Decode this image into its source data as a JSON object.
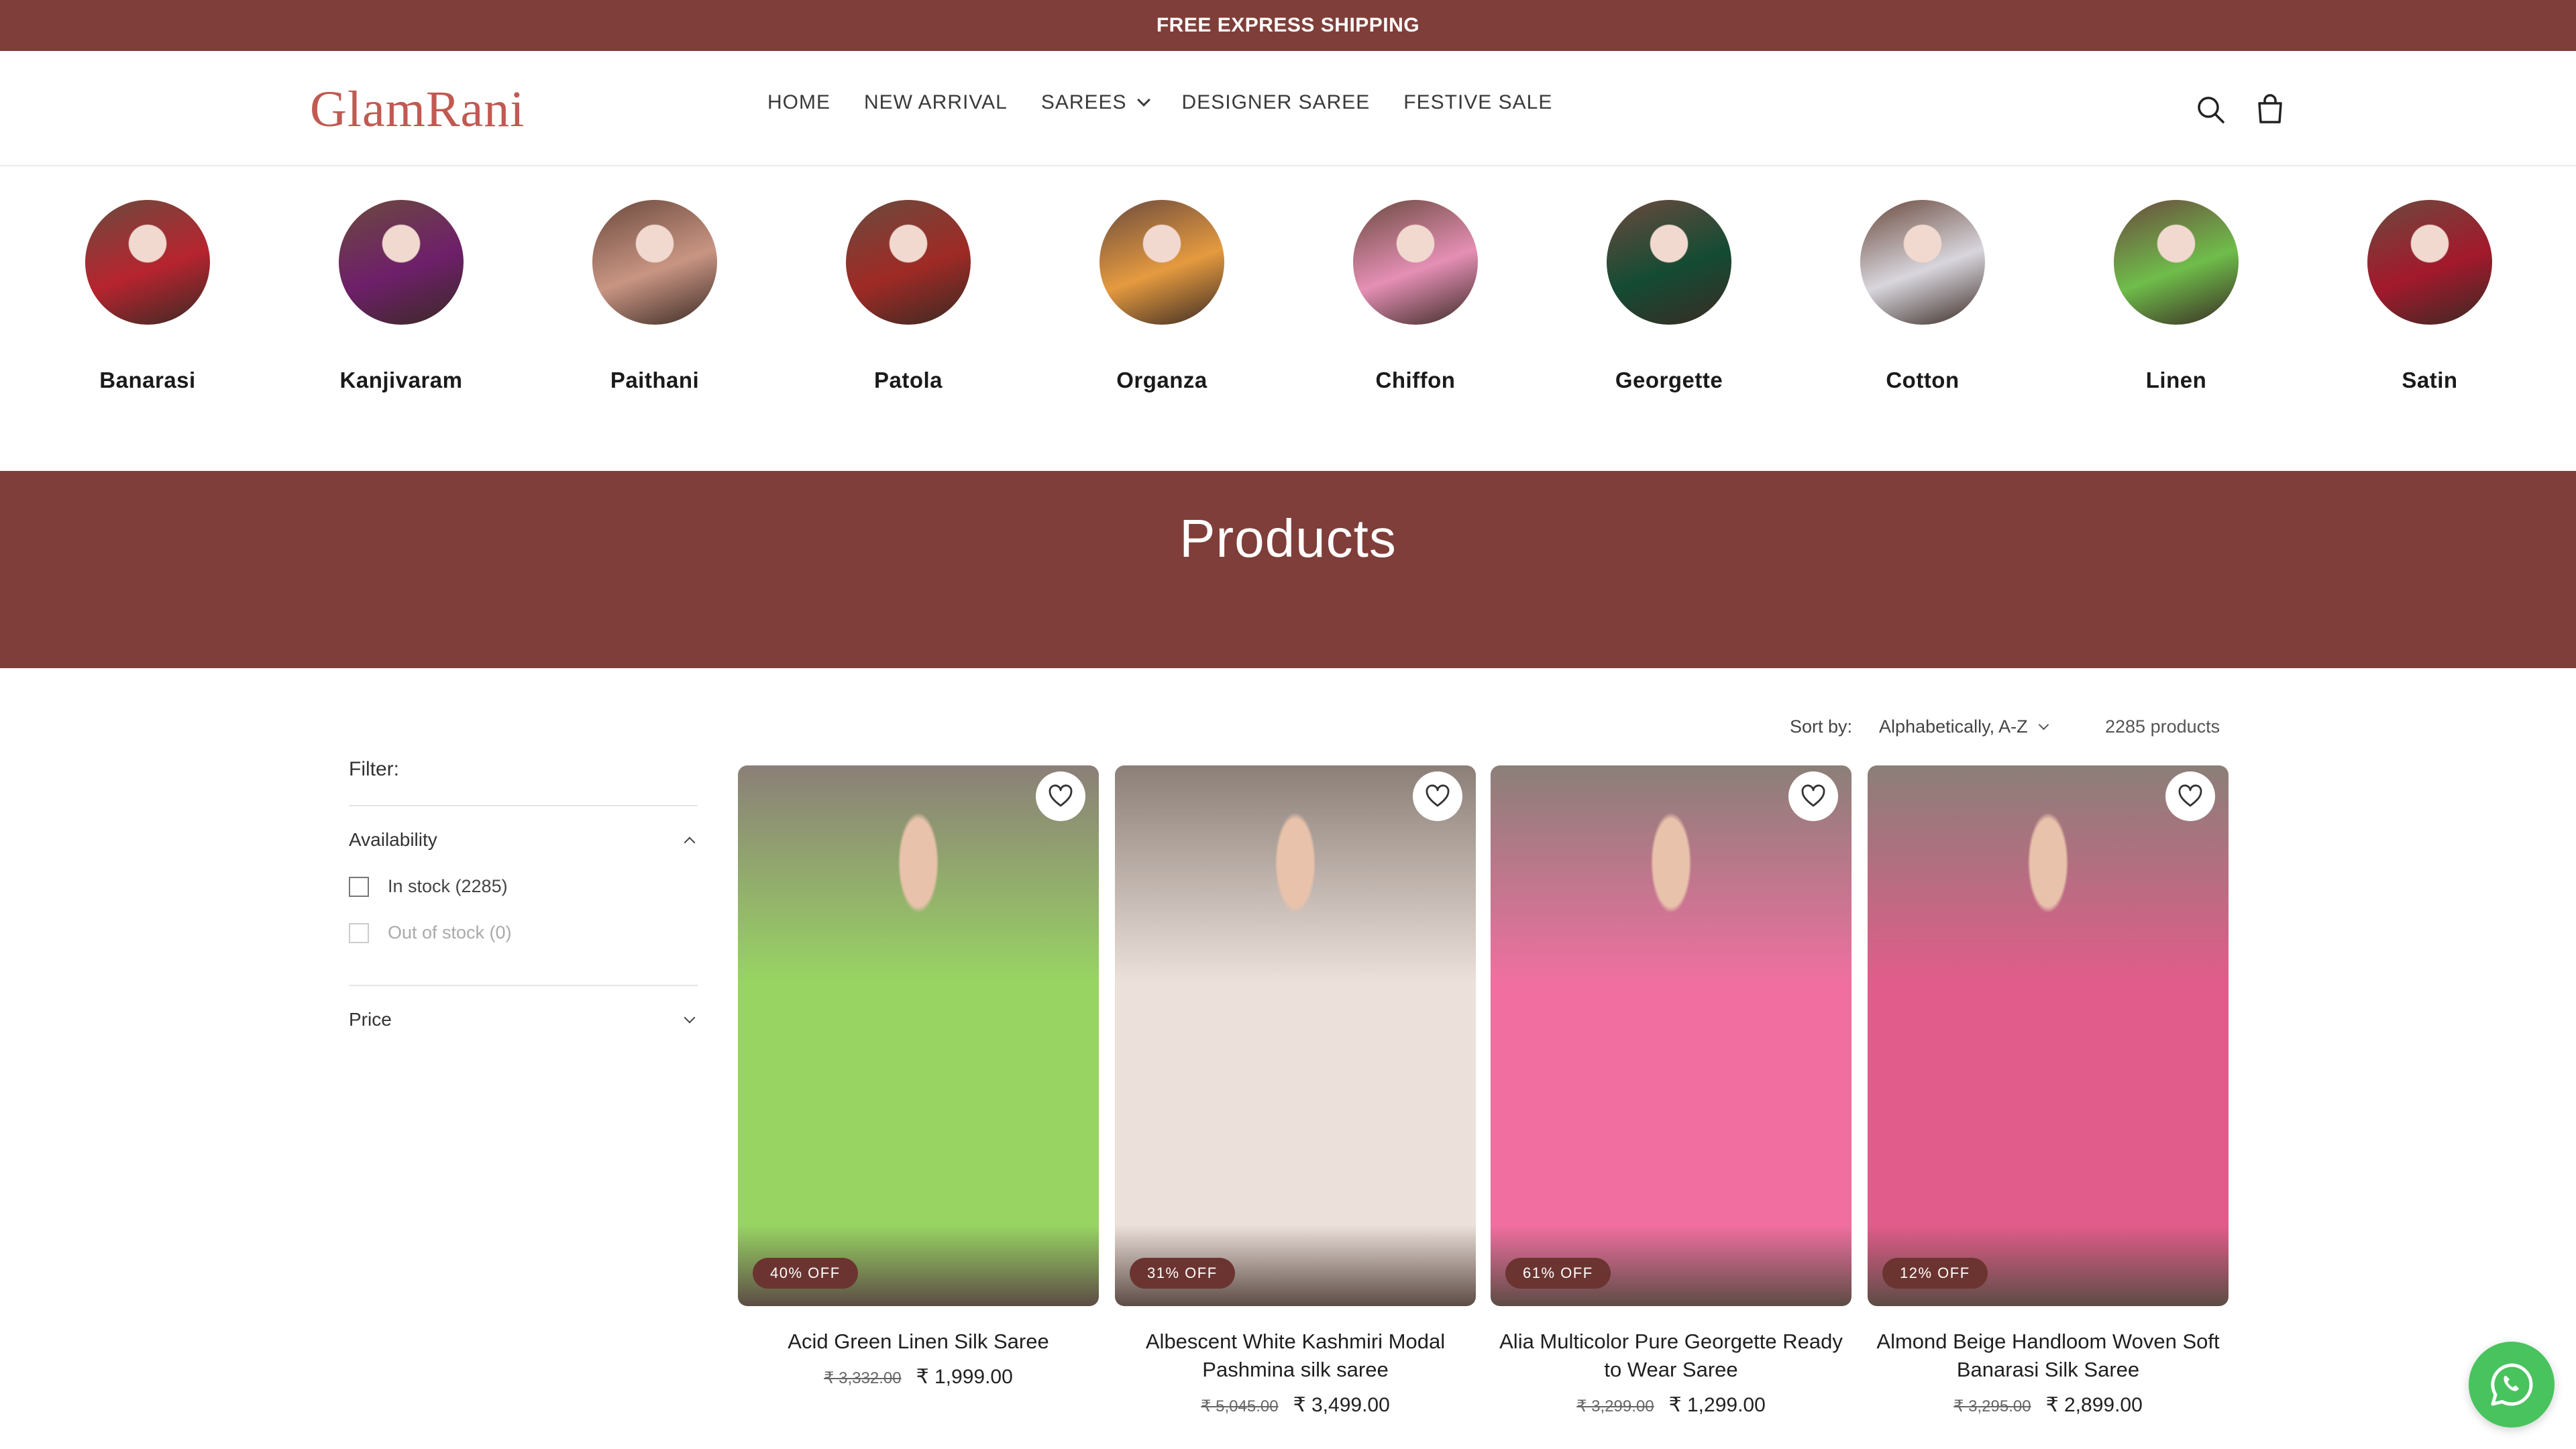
{
  "announcement": {
    "text": "FREE EXPRESS SHIPPING"
  },
  "header": {
    "logo_text": "GlamRani",
    "nav": [
      {
        "label": "HOME"
      },
      {
        "label": "NEW ARRIVAL"
      },
      {
        "label": "SAREES",
        "has_dropdown": true
      },
      {
        "label": "DESIGNER SAREE"
      },
      {
        "label": "FESTIVE SALE"
      }
    ],
    "icons": [
      "search-icon",
      "cart-icon"
    ]
  },
  "categories": [
    {
      "label": "Banarasi",
      "color": "#b7242f"
    },
    {
      "label": "Kanjivaram",
      "color": "#6e1f6a"
    },
    {
      "label": "Paithani",
      "color": "#c99583"
    },
    {
      "label": "Patola",
      "color": "#9f2a25"
    },
    {
      "label": "Organza",
      "color": "#e59a3f"
    },
    {
      "label": "Chiffon",
      "color": "#e58fb5"
    },
    {
      "label": "Georgette",
      "color": "#144b33"
    },
    {
      "label": "Cotton",
      "color": "#d8d6dd"
    },
    {
      "label": "Linen",
      "color": "#6fbd4a"
    },
    {
      "label": "Satin",
      "color": "#a3192c"
    }
  ],
  "banner": {
    "title": "Products"
  },
  "toolbar": {
    "sort_label": "Sort by:",
    "sort_value": "Alphabetically, A-Z",
    "product_count": "2285 products"
  },
  "filter": {
    "title": "Filter:",
    "availability": {
      "label": "Availability",
      "options": [
        {
          "label": "In stock (2285)",
          "disabled": false
        },
        {
          "label": "Out of stock (0)",
          "disabled": true
        }
      ]
    },
    "price": {
      "label": "Price"
    }
  },
  "products": [
    {
      "name": "Acid Green Linen Silk Saree",
      "old_price": "₹ 3,332.00",
      "price": "₹ 1,999.00",
      "badge": "40% OFF",
      "color": "#98d462"
    },
    {
      "name": "Albescent White Kashmiri Modal Pashmina silk saree",
      "old_price": "₹ 5,045.00",
      "price": "₹ 3,499.00",
      "badge": "31% OFF",
      "color": "#ece0da"
    },
    {
      "name": "Alia Multicolor Pure Georgette Ready to Wear Saree",
      "old_price": "₹ 3,299.00",
      "price": "₹ 1,299.00",
      "badge": "61% OFF",
      "color": "#f06fa0"
    },
    {
      "name": "Almond Beige Handloom Woven Soft Banarasi Silk Saree",
      "old_price": "₹ 3,295.00",
      "price": "₹ 2,899.00",
      "badge": "12% OFF",
      "color": "#e15c8a"
    }
  ],
  "colors": {
    "brand": "#7f3e39",
    "badge": "#6b3430",
    "whatsapp": "#48c35e"
  },
  "floating": {
    "icon": "whatsapp-icon"
  }
}
